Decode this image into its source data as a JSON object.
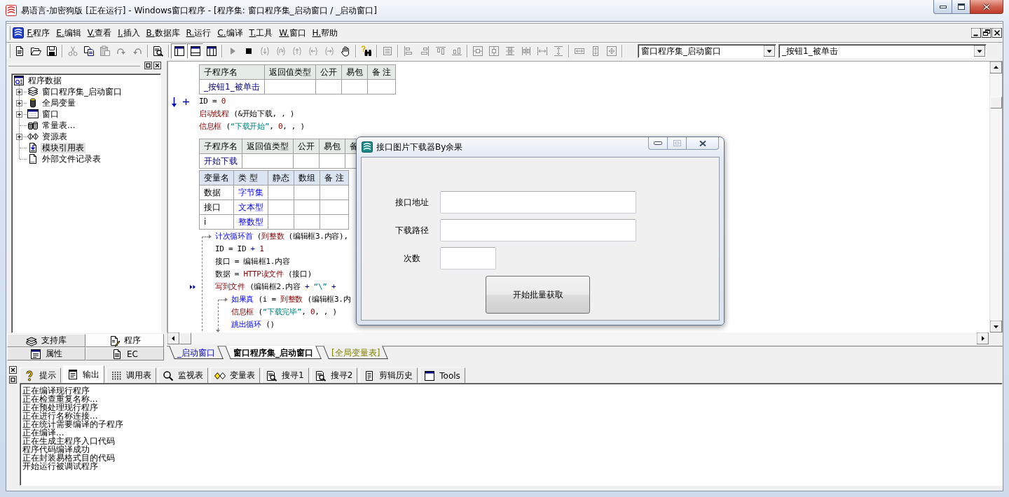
{
  "window": {
    "title": "易语言-加密狗版 [正在运行] - Windows窗口程序 - [程序集: 窗口程序集_启动窗口 / _启动窗口]"
  },
  "menu": [
    "F.程序",
    "E.编辑",
    "V.查看",
    "I.插入",
    "B.数据库",
    "R.运行",
    "C.编译",
    "T.工具",
    "W.窗口",
    "H.帮助"
  ],
  "toolbar": {
    "groups": [
      {
        "items": [
          {
            "kind": "new",
            "disabled": false
          },
          {
            "kind": "open",
            "disabled": false
          },
          {
            "kind": "save",
            "disabled": false
          }
        ]
      },
      {
        "items": [
          {
            "kind": "cut",
            "disabled": true
          },
          {
            "kind": "copy",
            "disabled": false
          },
          {
            "kind": "paste",
            "disabled": true
          },
          {
            "kind": "redo",
            "disabled": true
          },
          {
            "kind": "undo",
            "disabled": true
          }
        ]
      },
      {
        "items": [
          {
            "kind": "preview",
            "disabled": false
          }
        ]
      },
      {
        "items": [
          {
            "kind": "layout_left",
            "disabled": false,
            "pressed": true
          },
          {
            "kind": "layout_bottom",
            "disabled": false,
            "pressed": true
          },
          {
            "kind": "layout_split",
            "disabled": false,
            "pressed": false
          }
        ]
      },
      {
        "items": [
          {
            "kind": "run",
            "disabled": true
          },
          {
            "kind": "stop",
            "disabled": false
          },
          {
            "kind": "step_into",
            "disabled": true
          },
          {
            "kind": "step_over",
            "disabled": true
          },
          {
            "kind": "step_out",
            "disabled": true
          },
          {
            "kind": "step_back",
            "disabled": true
          },
          {
            "kind": "run_to",
            "disabled": true
          },
          {
            "kind": "hand",
            "disabled": false
          }
        ]
      },
      {
        "items": [
          {
            "kind": "find_help",
            "disabled": false
          }
        ]
      },
      {
        "items": [
          {
            "kind": "form",
            "disabled": true
          }
        ]
      },
      {
        "items": [
          {
            "kind": "align_left",
            "disabled": true
          },
          {
            "kind": "align_right",
            "disabled": true
          },
          {
            "kind": "align_top",
            "disabled": true
          },
          {
            "kind": "align_bottom",
            "disabled": true
          }
        ]
      },
      {
        "items": [
          {
            "kind": "center_h",
            "disabled": true
          },
          {
            "kind": "center_v",
            "disabled": true
          },
          {
            "kind": "space_top",
            "disabled": true
          },
          {
            "kind": "space_mid",
            "disabled": true
          },
          {
            "kind": "space_h",
            "disabled": true
          },
          {
            "kind": "space_v",
            "disabled": true
          }
        ]
      },
      {
        "items": [
          {
            "kind": "same_width",
            "disabled": true
          },
          {
            "kind": "same_height",
            "disabled": true
          },
          {
            "kind": "same_size",
            "disabled": true
          }
        ]
      }
    ],
    "selectors": [
      {
        "value": "窗口程序集_启动窗口"
      },
      {
        "value": "_按钮1_被单击"
      }
    ]
  },
  "project_tree": {
    "nodes": [
      {
        "kind": "root",
        "label": "程序数据",
        "selected": false,
        "children": [
          {
            "kind": "module",
            "label": "窗口程序集_启动窗口",
            "expanded": false,
            "selected": false
          },
          {
            "kind": "globals",
            "label": "全局变量",
            "expanded": false,
            "selected": false
          },
          {
            "kind": "window",
            "label": "窗口",
            "expanded": false,
            "selected": false
          },
          {
            "kind": "constants",
            "label": "常量表...",
            "selected": false
          },
          {
            "kind": "resources",
            "label": "资源表",
            "expanded": false,
            "selected": false
          },
          {
            "kind": "references",
            "label": "模块引用表",
            "selected": true
          },
          {
            "kind": "files",
            "label": "外部文件记录表",
            "selected": false
          }
        ]
      }
    ]
  },
  "panel_tabs": [
    {
      "tabs": [
        {
          "kind": "library",
          "label": "支持库",
          "selected": false
        },
        {
          "kind": "program",
          "label": "程序",
          "selected": true
        }
      ]
    },
    {
      "tabs": [
        {
          "kind": "properties",
          "label": "属性",
          "selected": false
        },
        {
          "kind": "ec",
          "label": "EC",
          "selected": false
        }
      ]
    }
  ],
  "editor": {
    "blocks": [
      {
        "kind": "sub_table",
        "columns": [
          "子程序名",
          "返回值类型",
          "公开",
          "易包",
          "备 注"
        ],
        "rows": [
          {
            "name": "_按钮1_被单击"
          }
        ]
      },
      {
        "kind": "code",
        "lines": [
          {
            "kind": "statement",
            "entry": true,
            "current": false,
            "tokens": [
              {
                "kind": "plain",
                "text": "ID = "
              },
              {
                "kind": "number",
                "text": "0"
              }
            ]
          },
          {
            "kind": "statement",
            "entry": false,
            "current": false,
            "tokens": [
              {
                "kind": "command",
                "text": "启动线程"
              },
              {
                "kind": "plain",
                "text": " (&开始下载, , )"
              }
            ]
          },
          {
            "kind": "statement",
            "entry": false,
            "current": false,
            "tokens": [
              {
                "kind": "command",
                "text": "信息框"
              },
              {
                "kind": "plain",
                "text": " ("
              },
              {
                "kind": "string",
                "text": "“下载开始”"
              },
              {
                "kind": "plain",
                "text": ", "
              },
              {
                "kind": "number",
                "text": "0"
              },
              {
                "kind": "plain",
                "text": ", , )"
              }
            ]
          }
        ]
      },
      {
        "kind": "sub_table",
        "columns": [
          "子程序名",
          "返回值类型",
          "公开",
          "易包",
          "备"
        ],
        "rows": [
          {
            "name": "开始下载"
          }
        ]
      },
      {
        "kind": "var_table",
        "columns": [
          "变量名",
          "类 型",
          "静态",
          "数组",
          "备 注"
        ],
        "rows": [
          {
            "name": "数据",
            "type": "字节集"
          },
          {
            "name": "接口",
            "type": "文本型"
          },
          {
            "name": "i",
            "type": "整数型"
          }
        ]
      },
      {
        "kind": "code",
        "lines": [
          {
            "kind": "loop",
            "entry": false,
            "current": false,
            "tokens": [
              {
                "kind": "flow",
                "text": "计次循环首"
              },
              {
                "kind": "plain",
                "text": " ("
              },
              {
                "kind": "command",
                "text": "到整数"
              },
              {
                "kind": "plain",
                "text": " (编辑框3.内容),"
              }
            ],
            "children": [
              {
                "kind": "statement",
                "entry": false,
                "current": false,
                "tokens": [
                  {
                    "kind": "plain",
                    "text": "ID = ID "
                  },
                  {
                    "kind": "operator",
                    "text": "+"
                  },
                  {
                    "kind": "number",
                    "text": " 1"
                  }
                ]
              },
              {
                "kind": "statement",
                "entry": false,
                "current": false,
                "tokens": [
                  {
                    "kind": "plain",
                    "text": "接口 = 编辑框1.内容"
                  }
                ]
              },
              {
                "kind": "statement",
                "entry": false,
                "current": false,
                "tokens": [
                  {
                    "kind": "plain",
                    "text": "数据 = "
                  },
                  {
                    "kind": "command",
                    "text": "HTTP读文件"
                  },
                  {
                    "kind": "plain",
                    "text": " (接口)"
                  }
                ]
              },
              {
                "kind": "statement",
                "entry": false,
                "current": true,
                "tokens": [
                  {
                    "kind": "command",
                    "text": "写到文件"
                  },
                  {
                    "kind": "plain",
                    "text": " (编辑框2.内容 "
                  },
                  {
                    "kind": "operator",
                    "text": "+"
                  },
                  {
                    "kind": "string",
                    "text": " “\\” "
                  },
                  {
                    "kind": "operator",
                    "text": "+"
                  }
                ]
              },
              {
                "kind": "if",
                "entry": false,
                "current": false,
                "tokens": [
                  {
                    "kind": "flow",
                    "text": "如果真"
                  },
                  {
                    "kind": "plain",
                    "text": " (i = "
                  },
                  {
                    "kind": "command",
                    "text": "到整数"
                  },
                  {
                    "kind": "plain",
                    "text": " (编辑框3.内"
                  }
                ],
                "children": [
                  {
                    "kind": "statement",
                    "entry": false,
                    "current": false,
                    "tokens": [
                      {
                        "kind": "command",
                        "text": "信息框"
                      },
                      {
                        "kind": "plain",
                        "text": " ("
                      },
                      {
                        "kind": "string",
                        "text": "“下载完毕”"
                      },
                      {
                        "kind": "plain",
                        "text": ", "
                      },
                      {
                        "kind": "number",
                        "text": "0"
                      },
                      {
                        "kind": "plain",
                        "text": ", , )"
                      }
                    ]
                  },
                  {
                    "kind": "statement",
                    "entry": false,
                    "current": false,
                    "tokens": [
                      {
                        "kind": "flow",
                        "text": "跳出循环"
                      },
                      {
                        "kind": "plain",
                        "text": " ()"
                      }
                    ]
                  }
                ]
              }
            ]
          }
        ]
      }
    ],
    "tabs": [
      {
        "kind": "window",
        "label": "_启动窗口",
        "selected": false
      },
      {
        "kind": "module",
        "label": "窗口程序集_启动窗口",
        "selected": true
      },
      {
        "kind": "globals",
        "label": "[全局变量表]",
        "selected": false
      }
    ]
  },
  "output_panel": {
    "tabs": [
      {
        "kind": "hint",
        "label": "提示",
        "selected": false
      },
      {
        "kind": "output",
        "label": "输出",
        "selected": true
      },
      {
        "kind": "calls",
        "label": "调用表",
        "selected": false
      },
      {
        "kind": "watch",
        "label": "监视表",
        "selected": false
      },
      {
        "kind": "vars",
        "label": "变量表",
        "selected": false
      },
      {
        "kind": "search",
        "label": "搜寻1",
        "selected": false
      },
      {
        "kind": "search",
        "label": "搜寻2",
        "selected": false
      },
      {
        "kind": "clips",
        "label": "剪辑历史",
        "selected": false
      },
      {
        "kind": "tools",
        "label": "Tools",
        "selected": false
      }
    ],
    "lines": [
      "正在编译现行程序",
      "正在检查重复名称...",
      "正在预处理现行程序",
      "正在进行名称连接...",
      "正在统计需要编译的子程序",
      "正在编译...",
      "正在生成主程序入口代码",
      "程序代码编译成功",
      "正在封装易格式目的代码",
      "开始运行被调试程序"
    ]
  },
  "dialog": {
    "title": "接口图片下载器By余果",
    "maximize": {
      "disabled": true
    },
    "fields": [
      {
        "label": "接口地址",
        "kind": "text"
      },
      {
        "label": "下载路径",
        "kind": "text"
      },
      {
        "label": "次数",
        "kind": "number"
      }
    ],
    "button": "开始批量获取"
  }
}
